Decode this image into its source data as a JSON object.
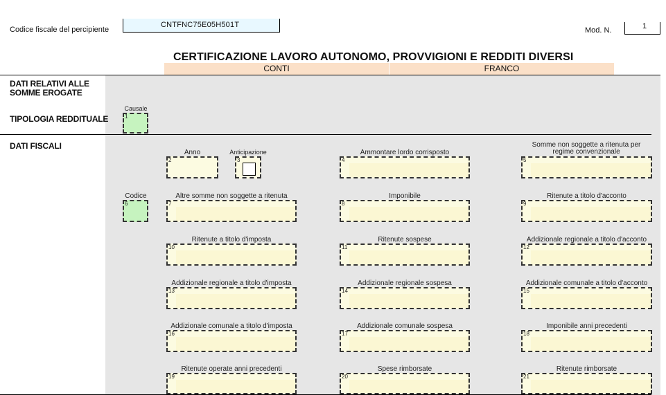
{
  "header": {
    "cf_label": "Codice fiscale del percipiente",
    "cf_value": "CNTFNC75E05H501T",
    "mod_label": "Mod. N.",
    "mod_value": "1",
    "title": "CERTIFICAZIONE LAVORO AUTONOMO, PROVVIGIONI E REDDITI DIVERSI",
    "surname": "CONTI",
    "name": "FRANCO"
  },
  "sections": {
    "somme_erogate": "DATI RELATIVI ALLE SOMME EROGATE",
    "tipologia": "TIPOLOGIA REDDITUALE",
    "dati_fiscali": "DATI FISCALI"
  },
  "fields": {
    "causale": {
      "label": "Causale",
      "num": "1"
    },
    "anno": {
      "label": "Anno",
      "num": "2"
    },
    "anticipazione": {
      "label": "Anticipazione",
      "num": "3"
    },
    "f4": {
      "label": "Ammontare lordo corrisposto",
      "num": "4"
    },
    "f5": {
      "label": "Somme non soggette a ritenuta per regime convenzionale",
      "num": "5"
    },
    "codice": {
      "label": "Codice",
      "num": "6"
    },
    "f7": {
      "label": "Altre somme non soggette a ritenuta",
      "num": "7"
    },
    "f8": {
      "label": "Imponibile",
      "num": "8"
    },
    "f9": {
      "label": "Ritenute a titolo d'acconto",
      "num": "9"
    },
    "f10": {
      "label": "Ritenute a titolo d'imposta",
      "num": "10"
    },
    "f11": {
      "label": "Ritenute sospese",
      "num": "11"
    },
    "f12": {
      "label": "Addizionale regionale a titolo d'acconto",
      "num": "12"
    },
    "f13": {
      "label": "Addizionale regionale a titolo d'imposta",
      "num": "13"
    },
    "f14": {
      "label": "Addizionale regionale sospesa",
      "num": "14"
    },
    "f15": {
      "label": "Addizionale comunale a titolo d'acconto",
      "num": "15"
    },
    "f16": {
      "label": "Addizionale comunale a titolo d'imposta",
      "num": "16"
    },
    "f17": {
      "label": "Addizionale comunale sospesa",
      "num": "17"
    },
    "f18": {
      "label": "Imponibile anni precedenti",
      "num": "18"
    },
    "f19": {
      "label": "Ritenute operate anni precedenti",
      "num": "19"
    },
    "f20": {
      "label": "Spese rimborsate",
      "num": "20"
    },
    "f21": {
      "label": "Ritenute rimborsate",
      "num": "21"
    }
  },
  "colors": {
    "field_fill": "#fcfbe1",
    "green_fill": "#c6f3bf",
    "panel": "#e6e6e6",
    "name_band": "#fbe0c8"
  }
}
